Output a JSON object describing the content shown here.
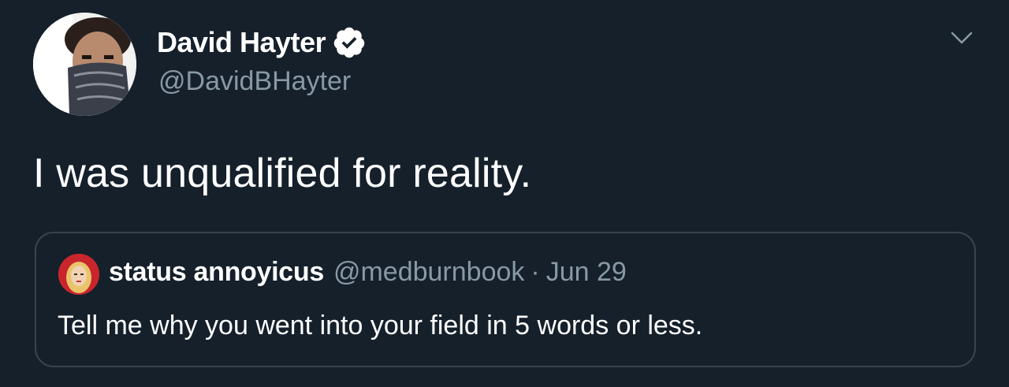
{
  "tweet": {
    "author": {
      "name": "David Hayter",
      "handle": "@DavidBHayter",
      "verified": true
    },
    "text": "I was unqualified for reality.",
    "menu_icon": "chevron-down-icon"
  },
  "quoted_tweet": {
    "author": {
      "name": "status annoyicus",
      "handle": "@medburnbook"
    },
    "separator": "·",
    "date": "Jun 29",
    "text": "Tell me why you went into your field in 5 words or less."
  },
  "colors": {
    "background": "#15202b",
    "primary_text": "#ffffff",
    "secondary_text": "#8899a6",
    "border": "#38444d"
  }
}
